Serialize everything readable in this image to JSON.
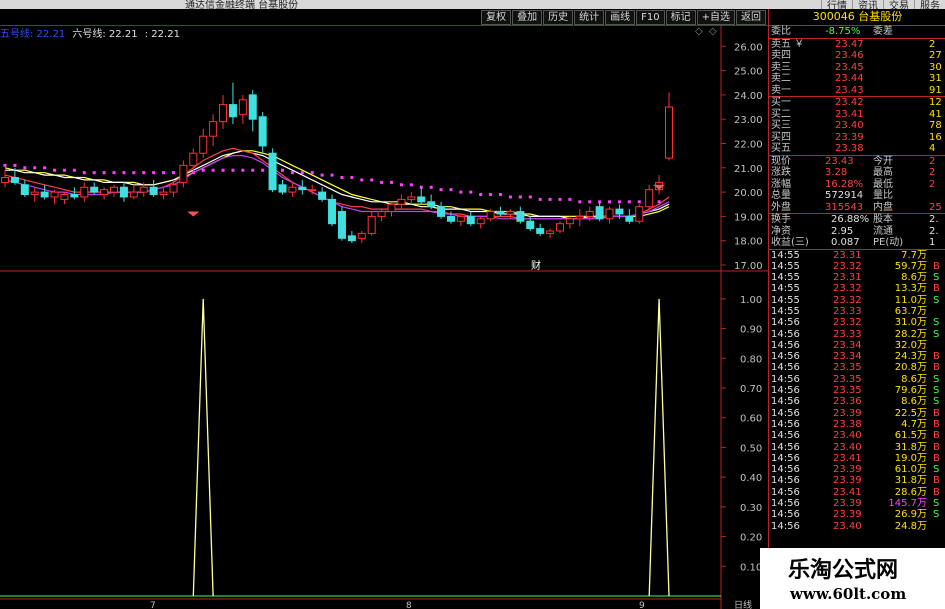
{
  "window": {
    "title": "通达信金融终端 台基股份",
    "top_buttons": [
      "行情",
      "资讯",
      "交易",
      "服务"
    ]
  },
  "toolbar": {
    "buttons": [
      "复权",
      "叠加",
      "历史",
      "统计",
      "画线",
      "F10",
      "标记",
      "+自选",
      "返回"
    ]
  },
  "legend": {
    "ma5": "五号线: 22.21",
    "ma6": "六号线: 22.21",
    "extra": ": 22.21",
    "ma5_color": "#3050ff",
    "ma6_color": "#e0e0e0"
  },
  "price_axis": [
    "26.00",
    "25.00",
    "24.00",
    "23.00",
    "22.00",
    "21.00",
    "20.00",
    "19.00",
    "18.00",
    "17.00"
  ],
  "indicator_axis": [
    "1.00",
    "0.90",
    "0.80",
    "0.70",
    "0.60",
    "0.50",
    "0.40",
    "0.30",
    "0.20",
    "0.10"
  ],
  "date_axis": [
    "7",
    "8",
    "9",
    "日线"
  ],
  "cai_marker": "财",
  "chart_data": [
    {
      "type": "candlestick",
      "ylim": [
        17.0,
        26.3
      ],
      "grid": false,
      "colors": {
        "up": "#ff3030",
        "down": "#40e0e0"
      },
      "candles": [
        {
          "o": 20.4,
          "h": 20.9,
          "l": 20.2,
          "c": 20.6
        },
        {
          "o": 20.6,
          "h": 21.0,
          "l": 20.3,
          "c": 20.4
        },
        {
          "o": 20.3,
          "h": 20.5,
          "l": 19.8,
          "c": 19.9
        },
        {
          "o": 19.9,
          "h": 20.2,
          "l": 19.6,
          "c": 20.0
        },
        {
          "o": 20.0,
          "h": 20.3,
          "l": 19.7,
          "c": 19.8
        },
        {
          "o": 19.8,
          "h": 20.1,
          "l": 19.5,
          "c": 20.0
        },
        {
          "o": 19.7,
          "h": 20.0,
          "l": 19.5,
          "c": 19.9
        },
        {
          "o": 19.9,
          "h": 20.2,
          "l": 19.7,
          "c": 19.8
        },
        {
          "o": 19.8,
          "h": 20.4,
          "l": 19.6,
          "c": 20.2
        },
        {
          "o": 20.2,
          "h": 20.4,
          "l": 19.9,
          "c": 20.0
        },
        {
          "o": 19.9,
          "h": 20.2,
          "l": 19.7,
          "c": 20.1
        },
        {
          "o": 20.0,
          "h": 20.3,
          "l": 19.8,
          "c": 20.2
        },
        {
          "o": 20.2,
          "h": 20.4,
          "l": 19.6,
          "c": 19.8
        },
        {
          "o": 19.8,
          "h": 20.3,
          "l": 19.7,
          "c": 20.0
        },
        {
          "o": 20.0,
          "h": 20.4,
          "l": 19.8,
          "c": 20.2
        },
        {
          "o": 20.2,
          "h": 20.5,
          "l": 19.8,
          "c": 19.9
        },
        {
          "o": 19.9,
          "h": 20.2,
          "l": 19.7,
          "c": 20.0
        },
        {
          "o": 20.0,
          "h": 20.5,
          "l": 19.8,
          "c": 20.3
        },
        {
          "o": 20.4,
          "h": 21.3,
          "l": 20.2,
          "c": 21.1
        },
        {
          "o": 21.1,
          "h": 21.8,
          "l": 20.8,
          "c": 21.6
        },
        {
          "o": 21.6,
          "h": 22.6,
          "l": 21.4,
          "c": 22.3
        },
        {
          "o": 22.3,
          "h": 23.2,
          "l": 21.9,
          "c": 22.9
        },
        {
          "o": 22.9,
          "h": 24.0,
          "l": 22.6,
          "c": 23.6
        },
        {
          "o": 23.6,
          "h": 24.5,
          "l": 22.8,
          "c": 23.1
        },
        {
          "o": 23.2,
          "h": 24.0,
          "l": 22.8,
          "c": 23.8
        },
        {
          "o": 24.0,
          "h": 24.2,
          "l": 22.5,
          "c": 23.0
        },
        {
          "o": 23.1,
          "h": 23.3,
          "l": 21.6,
          "c": 21.9
        },
        {
          "o": 21.6,
          "h": 21.8,
          "l": 20.0,
          "c": 20.1
        },
        {
          "o": 20.3,
          "h": 20.5,
          "l": 19.9,
          "c": 20.0
        },
        {
          "o": 20.0,
          "h": 20.4,
          "l": 19.8,
          "c": 20.2
        },
        {
          "o": 20.2,
          "h": 20.5,
          "l": 19.9,
          "c": 20.1
        },
        {
          "o": 20.1,
          "h": 20.3,
          "l": 19.9,
          "c": 20.1
        },
        {
          "o": 20.0,
          "h": 20.2,
          "l": 19.6,
          "c": 19.7
        },
        {
          "o": 19.7,
          "h": 19.9,
          "l": 18.6,
          "c": 18.7
        },
        {
          "o": 19.2,
          "h": 19.4,
          "l": 18.0,
          "c": 18.1
        },
        {
          "o": 18.2,
          "h": 18.4,
          "l": 17.9,
          "c": 18.0
        },
        {
          "o": 18.1,
          "h": 18.4,
          "l": 17.9,
          "c": 18.3
        },
        {
          "o": 18.3,
          "h": 19.2,
          "l": 18.2,
          "c": 19.0
        },
        {
          "o": 19.0,
          "h": 19.3,
          "l": 18.8,
          "c": 19.2
        },
        {
          "o": 19.2,
          "h": 19.6,
          "l": 19.0,
          "c": 19.5
        },
        {
          "o": 19.5,
          "h": 19.9,
          "l": 19.3,
          "c": 19.7
        },
        {
          "o": 19.7,
          "h": 20.0,
          "l": 19.5,
          "c": 19.8
        },
        {
          "o": 19.8,
          "h": 20.2,
          "l": 19.5,
          "c": 19.6
        },
        {
          "o": 19.6,
          "h": 19.9,
          "l": 19.3,
          "c": 19.4
        },
        {
          "o": 19.4,
          "h": 19.6,
          "l": 18.9,
          "c": 19.0
        },
        {
          "o": 19.0,
          "h": 19.2,
          "l": 18.7,
          "c": 18.8
        },
        {
          "o": 18.8,
          "h": 19.1,
          "l": 18.6,
          "c": 19.0
        },
        {
          "o": 19.0,
          "h": 19.2,
          "l": 18.6,
          "c": 18.7
        },
        {
          "o": 18.7,
          "h": 19.0,
          "l": 18.5,
          "c": 18.9
        },
        {
          "o": 18.9,
          "h": 19.3,
          "l": 18.8,
          "c": 19.2
        },
        {
          "o": 19.2,
          "h": 19.4,
          "l": 19.0,
          "c": 19.1
        },
        {
          "o": 19.1,
          "h": 19.3,
          "l": 18.9,
          "c": 19.2
        },
        {
          "o": 19.2,
          "h": 19.4,
          "l": 18.7,
          "c": 18.8
        },
        {
          "o": 18.8,
          "h": 19.0,
          "l": 18.4,
          "c": 18.5
        },
        {
          "o": 18.5,
          "h": 18.7,
          "l": 18.2,
          "c": 18.3
        },
        {
          "o": 18.3,
          "h": 18.5,
          "l": 18.1,
          "c": 18.4
        },
        {
          "o": 18.4,
          "h": 18.8,
          "l": 18.3,
          "c": 18.7
        },
        {
          "o": 18.7,
          "h": 19.0,
          "l": 18.5,
          "c": 18.9
        },
        {
          "o": 18.9,
          "h": 19.3,
          "l": 18.6,
          "c": 19.0
        },
        {
          "o": 19.0,
          "h": 19.4,
          "l": 18.8,
          "c": 19.2
        },
        {
          "o": 19.4,
          "h": 19.6,
          "l": 18.8,
          "c": 18.9
        },
        {
          "o": 18.9,
          "h": 19.4,
          "l": 18.7,
          "c": 19.3
        },
        {
          "o": 19.3,
          "h": 19.5,
          "l": 18.9,
          "c": 19.1
        },
        {
          "o": 19.0,
          "h": 19.3,
          "l": 18.7,
          "c": 18.8
        },
        {
          "o": 18.8,
          "h": 19.5,
          "l": 18.7,
          "c": 19.4
        },
        {
          "o": 19.4,
          "h": 20.3,
          "l": 19.2,
          "c": 20.1
        },
        {
          "o": 20.1,
          "h": 20.7,
          "l": 19.9,
          "c": 20.4
        },
        {
          "o": 21.4,
          "h": 24.1,
          "l": 21.3,
          "c": 23.5
        }
      ],
      "ma_lines": [
        {
          "color": "#ffff40",
          "values": [
            21.0,
            20.9,
            20.9,
            20.8,
            20.8,
            20.7,
            20.7,
            20.6,
            20.6,
            20.5,
            20.5,
            20.4,
            20.4,
            20.4,
            20.3,
            20.3,
            20.4,
            20.5,
            20.6,
            20.8,
            21.0,
            21.2,
            21.4,
            21.6,
            21.7,
            21.7,
            21.6,
            21.5,
            21.3,
            21.1,
            20.9,
            20.7,
            20.5,
            20.3,
            20.1,
            19.9,
            19.8,
            19.7,
            19.6,
            19.6,
            19.6,
            19.5,
            19.5,
            19.5,
            19.4,
            19.4,
            19.3,
            19.3,
            19.3,
            19.2,
            19.2,
            19.2,
            19.1,
            19.1,
            19.0,
            19.0,
            19.0,
            19.0,
            19.0,
            19.0,
            19.0,
            19.0,
            19.0,
            19.0,
            19.0,
            19.1,
            19.2,
            19.4
          ]
        },
        {
          "color": "#ffffff",
          "values": [
            20.9,
            20.9,
            20.8,
            20.8,
            20.7,
            20.7,
            20.6,
            20.6,
            20.5,
            20.5,
            20.4,
            20.4,
            20.4,
            20.3,
            20.3,
            20.3,
            20.4,
            20.5,
            20.7,
            20.9,
            21.1,
            21.3,
            21.5,
            21.6,
            21.7,
            21.6,
            21.5,
            21.3,
            21.1,
            20.9,
            20.7,
            20.5,
            20.3,
            20.1,
            19.9,
            19.8,
            19.7,
            19.6,
            19.6,
            19.5,
            19.5,
            19.5,
            19.4,
            19.4,
            19.3,
            19.3,
            19.3,
            19.2,
            19.2,
            19.2,
            19.1,
            19.1,
            19.1,
            19.0,
            19.0,
            19.0,
            19.0,
            18.9,
            18.9,
            19.0,
            19.0,
            19.0,
            19.0,
            19.0,
            19.1,
            19.2,
            19.3,
            19.5
          ]
        },
        {
          "color": "#ff4040",
          "values": [
            20.7,
            20.6,
            20.5,
            20.4,
            20.3,
            20.2,
            20.1,
            20.0,
            20.0,
            20.0,
            20.0,
            20.0,
            20.0,
            20.0,
            20.0,
            20.1,
            20.2,
            20.4,
            20.7,
            21.0,
            21.3,
            21.5,
            21.7,
            21.8,
            21.7,
            21.6,
            21.3,
            21.0,
            20.7,
            20.4,
            20.2,
            20.0,
            19.8,
            19.6,
            19.5,
            19.4,
            19.4,
            19.3,
            19.3,
            19.3,
            19.3,
            19.3,
            19.3,
            19.2,
            19.2,
            19.1,
            19.1,
            19.0,
            19.0,
            19.0,
            19.0,
            19.0,
            18.9,
            18.9,
            18.9,
            18.9,
            18.9,
            18.9,
            18.9,
            18.9,
            19.0,
            19.0,
            19.0,
            19.0,
            19.1,
            19.3,
            19.5,
            19.8
          ]
        },
        {
          "color": "#c040ff",
          "values": [
            20.5,
            20.4,
            20.3,
            20.2,
            20.1,
            20.0,
            20.0,
            19.9,
            19.9,
            19.9,
            19.9,
            20.0,
            20.0,
            20.0,
            20.0,
            20.1,
            20.2,
            20.3,
            20.5,
            20.8,
            21.0,
            21.2,
            21.4,
            21.5,
            21.5,
            21.4,
            21.2,
            20.9,
            20.6,
            20.4,
            20.2,
            20.0,
            19.8,
            19.6,
            19.4,
            19.3,
            19.2,
            19.2,
            19.2,
            19.2,
            19.2,
            19.2,
            19.2,
            19.2,
            19.1,
            19.1,
            19.0,
            19.0,
            19.0,
            19.0,
            18.9,
            18.9,
            18.9,
            18.9,
            18.9,
            18.9,
            18.9,
            18.9,
            18.9,
            18.9,
            18.9,
            19.0,
            19.0,
            19.0,
            19.1,
            19.2,
            19.4,
            19.6
          ]
        }
      ],
      "dot_line": {
        "color": "#ff40ff",
        "values": [
          21.1,
          21.1,
          21.0,
          21.0,
          21.0,
          20.9,
          20.9,
          20.9,
          20.8,
          20.8,
          20.8,
          20.8,
          20.8,
          20.8,
          20.8,
          20.8,
          20.8,
          20.8,
          20.8,
          20.8,
          20.9,
          20.9,
          20.9,
          20.9,
          20.9,
          20.9,
          20.9,
          20.9,
          20.9,
          20.8,
          20.8,
          20.8,
          20.7,
          20.7,
          20.6,
          20.6,
          20.5,
          20.5,
          20.4,
          20.4,
          20.3,
          20.3,
          20.2,
          20.2,
          20.1,
          20.1,
          20.0,
          20.0,
          19.9,
          19.9,
          19.9,
          19.8,
          19.8,
          19.8,
          19.7,
          19.7,
          19.7,
          19.7,
          19.6,
          19.6,
          19.6,
          19.6,
          19.6,
          19.6,
          19.6,
          19.6,
          19.6
        ]
      },
      "signals": [
        {
          "index": 19,
          "price": 19.2,
          "color": "#ff5060"
        },
        {
          "index": 66,
          "price": 20.3,
          "color": "#ff5060"
        }
      ]
    },
    {
      "type": "line",
      "ylim": [
        0.0,
        1.05
      ],
      "color": "#ffffa0",
      "spikes": [
        {
          "center_index": 20,
          "value": 1.0,
          "base_start": 19,
          "base_end": 21
        },
        {
          "center_index": 66,
          "value": 1.0,
          "base_start": 65,
          "base_end": 67
        }
      ],
      "baseline_color": "#40ff40"
    }
  ],
  "quote": {
    "code_name": "300046 台基股份",
    "weibi_label": "委比",
    "weibi_value": "-8.75%",
    "weicha_label": "委差",
    "sell": [
      {
        "label": "卖五 ￥",
        "price": "23.47",
        "vol": "2"
      },
      {
        "label": "卖四",
        "price": "23.46",
        "vol": "27"
      },
      {
        "label": "卖三",
        "price": "23.45",
        "vol": "30"
      },
      {
        "label": "卖二",
        "price": "23.44",
        "vol": "31"
      },
      {
        "label": "卖一",
        "price": "23.43",
        "vol": "91"
      }
    ],
    "buy": [
      {
        "label": "买一",
        "price": "23.42",
        "vol": "12"
      },
      {
        "label": "买二",
        "price": "23.41",
        "vol": "41"
      },
      {
        "label": "买三",
        "price": "23.40",
        "vol": "78"
      },
      {
        "label": "买四",
        "price": "23.39",
        "vol": "16"
      },
      {
        "label": "买五",
        "price": "23.38",
        "vol": "4"
      }
    ],
    "stats": [
      {
        "l1": "现价",
        "v1": "23.43",
        "c1": "red",
        "l2": "今开",
        "v2": "2"
      },
      {
        "l1": "涨跌",
        "v1": "3.28",
        "c1": "red",
        "l2": "最高",
        "v2": "2"
      },
      {
        "l1": "涨幅",
        "v1": "16.28%",
        "c1": "red",
        "l2": "最低",
        "v2": "2"
      },
      {
        "l1": "总量",
        "v1": "572914",
        "c1": "white",
        "l2": "量比",
        "v2": ""
      },
      {
        "l1": "外盘",
        "v1": "315543",
        "c1": "red",
        "l2": "内盘",
        "v2": "25"
      }
    ],
    "stats2": [
      {
        "l1": "换手",
        "v1": "26.88%",
        "l2": "股本",
        "v2": "2."
      },
      {
        "l1": "净资",
        "v1": "2.95",
        "l2": "流通",
        "v2": "2."
      },
      {
        "l1": "收益(三)",
        "v1": "0.087",
        "l2": "PE(动)",
        "v2": "1"
      }
    ],
    "ticks": [
      {
        "t": "14:55",
        "p": "23.31",
        "v": "7.7万",
        "s": ""
      },
      {
        "t": "14:55",
        "p": "23.32",
        "v": "59.7万",
        "s": "B"
      },
      {
        "t": "14:55",
        "p": "23.31",
        "v": "8.6万",
        "s": "S"
      },
      {
        "t": "14:55",
        "p": "23.32",
        "v": "13.3万",
        "s": "B"
      },
      {
        "t": "14:55",
        "p": "23.32",
        "v": "11.0万",
        "s": "S"
      },
      {
        "t": "14:55",
        "p": "23.33",
        "v": "63.7万",
        "s": ""
      },
      {
        "t": "14:56",
        "p": "23.32",
        "v": "31.0万",
        "s": "S"
      },
      {
        "t": "14:56",
        "p": "23.33",
        "v": "28.2万",
        "s": "S"
      },
      {
        "t": "14:56",
        "p": "23.34",
        "v": "32.0万",
        "s": ""
      },
      {
        "t": "14:56",
        "p": "23.34",
        "v": "24.3万",
        "s": "B"
      },
      {
        "t": "14:56",
        "p": "23.35",
        "v": "20.8万",
        "s": "B"
      },
      {
        "t": "14:56",
        "p": "23.35",
        "v": "8.6万",
        "s": "S"
      },
      {
        "t": "14:56",
        "p": "23.35",
        "v": "79.6万",
        "s": "S"
      },
      {
        "t": "14:56",
        "p": "23.36",
        "v": "8.6万",
        "s": "S"
      },
      {
        "t": "14:56",
        "p": "23.39",
        "v": "22.5万",
        "s": "B"
      },
      {
        "t": "14:56",
        "p": "23.38",
        "v": "4.7万",
        "s": "B"
      },
      {
        "t": "14:56",
        "p": "23.40",
        "v": "61.5万",
        "s": "B"
      },
      {
        "t": "14:56",
        "p": "23.40",
        "v": "31.8万",
        "s": "B"
      },
      {
        "t": "14:56",
        "p": "23.41",
        "v": "19.0万",
        "s": "B"
      },
      {
        "t": "14:56",
        "p": "23.39",
        "v": "61.0万",
        "s": "S"
      },
      {
        "t": "14:56",
        "p": "23.39",
        "v": "31.8万",
        "s": "B"
      },
      {
        "t": "14:56",
        "p": "23.41",
        "v": "28.6万",
        "s": "B"
      },
      {
        "t": "14:56",
        "p": "23.39",
        "v": "145.7万",
        "s": "S"
      },
      {
        "t": "14:56",
        "p": "23.39",
        "v": "26.9万",
        "s": "S"
      },
      {
        "t": "14:56",
        "p": "23.40",
        "v": "24.8万",
        "s": ""
      }
    ]
  },
  "watermark": {
    "line1": "乐淘公式网",
    "line2": "www.60lt.com"
  }
}
